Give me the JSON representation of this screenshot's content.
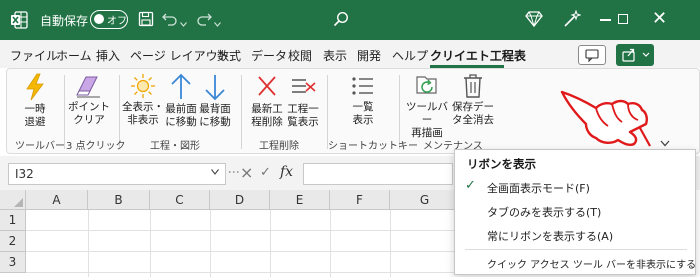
{
  "titlebar": {
    "autosave_label": "自動保存",
    "autosave_state": "オフ",
    "colors": {
      "bar": "#217346",
      "accent": "#217346"
    }
  },
  "icons": {
    "app": "excel-logo-icon",
    "save": "save-icon",
    "undo": "undo-icon",
    "redo": "redo-icon",
    "search": "search-icon",
    "diamond": "diamond-icon",
    "wand": "magic-wand-icon",
    "minimize": "minimize-icon",
    "maximize": "maximize-icon",
    "close": "close-icon",
    "comment": "comment-icon",
    "share": "share-icon",
    "collapse": "chevron-down-icon",
    "hand": "pointing-hand-icon"
  },
  "tabs": [
    {
      "label": "ファイル",
      "active": false
    },
    {
      "label": "ホーム",
      "active": false
    },
    {
      "label": "挿入",
      "active": false
    },
    {
      "label": "ページ レイアウト",
      "active": false
    },
    {
      "label": "数式",
      "active": false
    },
    {
      "label": "データ",
      "active": false
    },
    {
      "label": "校閲",
      "active": false
    },
    {
      "label": "表示",
      "active": false
    },
    {
      "label": "開発",
      "active": false
    },
    {
      "label": "ヘルプ",
      "active": false
    },
    {
      "label": "クリイエト工程表",
      "active": true
    }
  ],
  "ribbon": {
    "buttons": [
      {
        "label": "一時\n退避",
        "icon": "lightning-icon"
      },
      {
        "label": "ポイント\nクリア",
        "icon": "eraser-icon"
      },
      {
        "label": "全表示・\n非表示",
        "icon": "sun-icon"
      },
      {
        "label": "最前面\nに移動",
        "icon": "arrow-up-icon"
      },
      {
        "label": "最背面\nに移動",
        "icon": "arrow-down-icon"
      },
      {
        "label": "最新工\n程削除",
        "icon": "red-x-icon"
      },
      {
        "label": "工程一\n覧表示",
        "icon": "list-x-icon"
      },
      {
        "label": "一覧\n表示",
        "icon": "list-icon"
      },
      {
        "label": "ツールバー\n再描画",
        "icon": "refresh-icon"
      },
      {
        "label": "保存デー\nタ全消去",
        "icon": "trash-icon"
      }
    ],
    "groups": [
      "ツールバー",
      "3 点クリック",
      "工程・図形",
      "工程削除",
      "ショートカットキー",
      "メンテナンス"
    ]
  },
  "formula_bar": {
    "name_box": "I32",
    "formula": ""
  },
  "sheet": {
    "columns": [
      "A",
      "B",
      "C",
      "D",
      "E",
      "F",
      "G"
    ],
    "rows": [
      "1",
      "2",
      "3"
    ]
  },
  "ribbon_menu": {
    "title": "リボンを表示",
    "items": [
      {
        "label": "全画面表示モード(F)",
        "checked": true
      },
      {
        "label": "タブのみを表示する(T)",
        "checked": false
      },
      {
        "label": "常にリボンを表示する(A)",
        "checked": false
      },
      {
        "label": "クイック アクセス ツール バーを非表示にする (H)",
        "checked": false
      }
    ]
  }
}
